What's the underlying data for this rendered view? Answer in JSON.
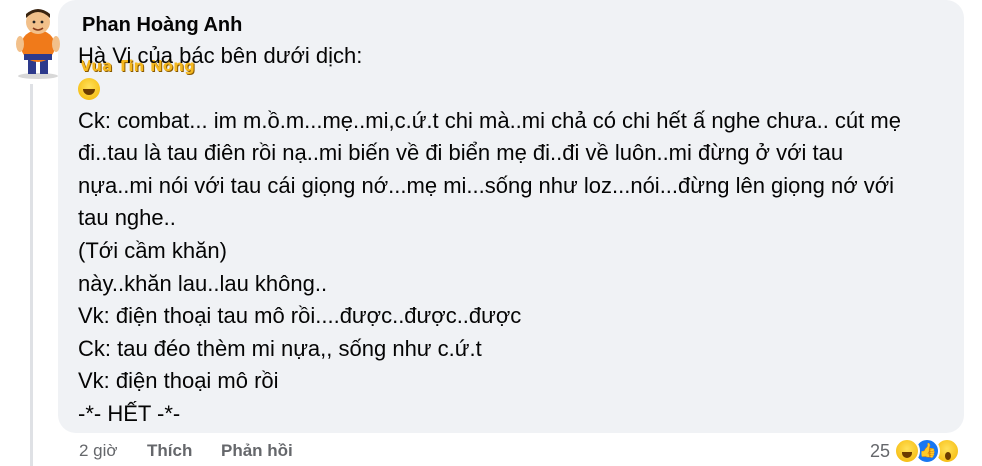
{
  "comment": {
    "author": "Phan Hoàng Anh",
    "watermark": "Vua Tin Nóng",
    "lines": [
      "Hà Vi của bác bên dưới dịch:",
      "Ck: combat... im m.ồ.m...mẹ..mi,c.ứ.t chi mà..mi chả có chi hết ấ nghe chưa.. cút mẹ",
      "đi..tau là tau điên rồi nạ..mi biến về đi biển mẹ đi..đi về luôn..mi đừng ở với tau",
      "nựa..mi nói với tau cái giọng nớ...mẹ mi...sống như loz...nói...đừng lên giọng nớ với",
      "tau nghe..",
      "(Tới cầm khăn)",
      "này..khăn lau..lau không..",
      "Vk: điện thoại tau mô rồi....được..được..được",
      "Ck: tau đéo thèm mi nựa,, sống như c.ứ.t",
      "Vk: điện thoại mô rồi",
      "-*- HẾT -*-"
    ],
    "emoji_icon": "laughing-face-icon"
  },
  "actions": {
    "time": "2 giờ",
    "like": "Thích",
    "reply": "Phản hồi"
  },
  "reactions": {
    "count": "25",
    "icons": [
      "haha-reaction-icon",
      "like-reaction-icon",
      "wow-reaction-icon"
    ]
  },
  "colors": {
    "bubble": "#f0f2f5",
    "text": "#050505",
    "muted": "#65676b",
    "like_blue": "#1877f2",
    "watermark": "#f5b81f"
  }
}
